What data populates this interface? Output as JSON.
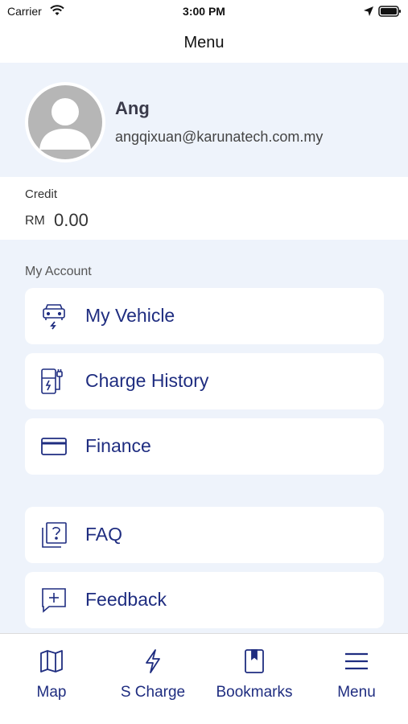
{
  "status_bar": {
    "carrier": "Carrier",
    "time": "3:00 PM",
    "icons": [
      "wifi-icon",
      "location-arrow-icon",
      "battery-icon"
    ]
  },
  "nav": {
    "title": "Menu"
  },
  "profile": {
    "name": "Ang",
    "email": "angqixuan@karunatech.com.my",
    "avatar_icon": "user-avatar-icon"
  },
  "credit": {
    "label": "Credit",
    "currency": "RM",
    "amount": "0.00"
  },
  "my_account": {
    "title": "My Account",
    "items": [
      {
        "label": "My Vehicle",
        "icon": "vehicle-icon"
      },
      {
        "label": "Charge History",
        "icon": "charger-icon"
      },
      {
        "label": "Finance",
        "icon": "credit-card-icon"
      }
    ]
  },
  "support": {
    "items": [
      {
        "label": "FAQ",
        "icon": "faq-icon"
      },
      {
        "label": "Feedback",
        "icon": "feedback-icon"
      }
    ]
  },
  "tab_bar": {
    "tabs": [
      {
        "label": "Map",
        "icon": "map-icon"
      },
      {
        "label": "S Charge",
        "icon": "lightning-icon"
      },
      {
        "label": "Bookmarks",
        "icon": "bookmark-icon"
      },
      {
        "label": "Menu",
        "icon": "hamburger-menu-icon"
      }
    ]
  },
  "colors": {
    "accent": "#1f2d80",
    "page_background": "#eef3fb",
    "card_background": "#ffffff",
    "avatar_gray": "#b6b6b6"
  }
}
